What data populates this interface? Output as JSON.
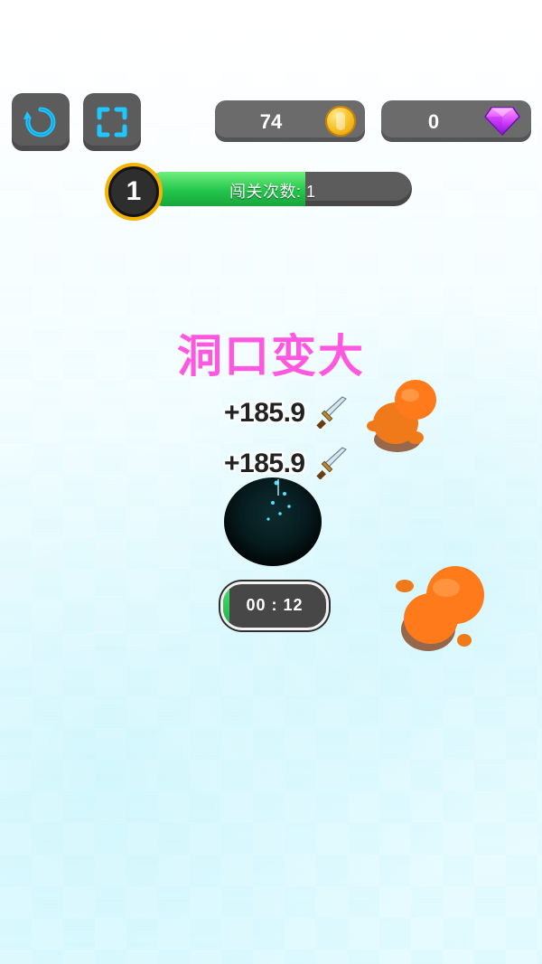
{
  "hud": {
    "coins": "74",
    "gems": "0",
    "level": "1",
    "progress_label": "闯关次数: 1",
    "progress_fraction": 0.6
  },
  "banner": {
    "text": "洞口变大"
  },
  "bonuses": [
    {
      "text": "+185.9"
    },
    {
      "text": "+185.9"
    }
  ],
  "timer": {
    "text": "00 : 12",
    "fraction": 0.06
  },
  "colors": {
    "button_gray": "#5c5c5c",
    "pill_gray": "#6b6b6b",
    "progress_green": "#23c64b",
    "banner_pink": "#ff58e0",
    "character_orange": "#ff7a1a",
    "hole_black": "#071d20",
    "badge_gold": "#f4b400"
  },
  "icons": {
    "restart": "restart-icon",
    "fullscreen": "fullscreen-icon",
    "coin": "coin-icon",
    "gem": "gem-icon",
    "sword": "sword-icon"
  }
}
